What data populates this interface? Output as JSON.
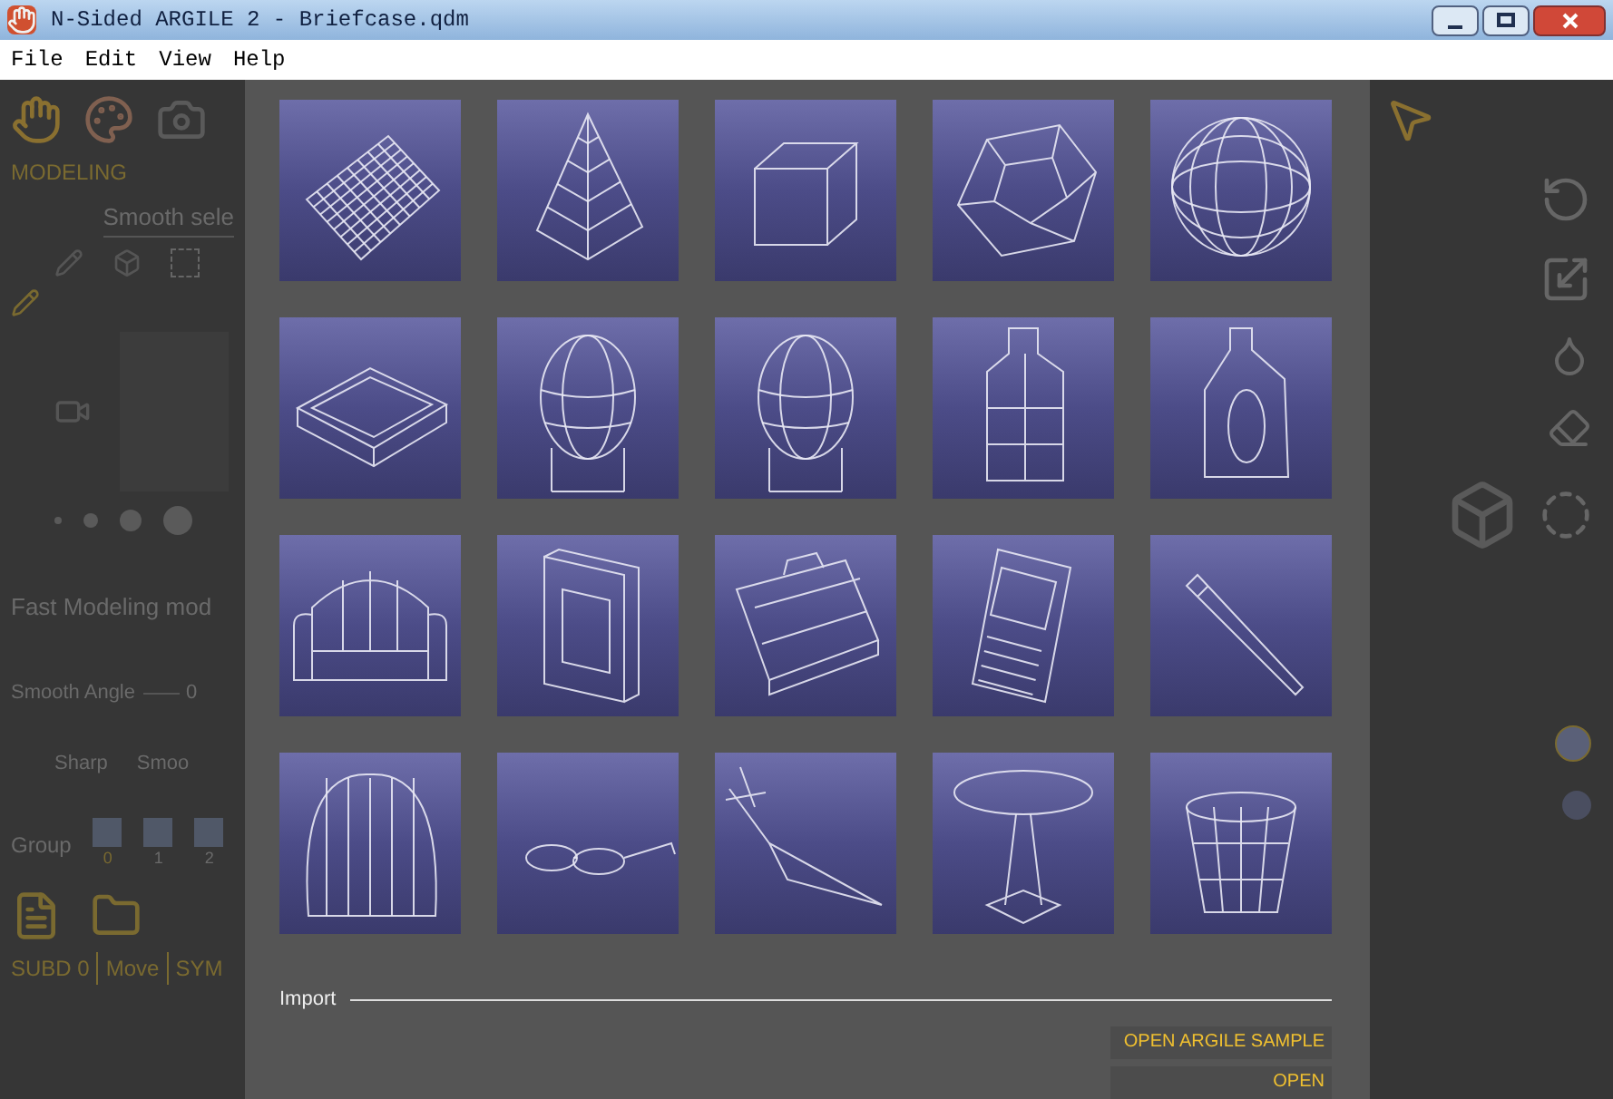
{
  "window": {
    "title": "N-Sided ARGILE 2 - Briefcase.qdm"
  },
  "menu": [
    "File",
    "Edit",
    "View",
    "Help"
  ],
  "left_panel": {
    "section": "MODELING",
    "smooth_select": "Smooth sele",
    "mode": "Fast Modeling mod",
    "smooth_angle_label": "Smooth Angle",
    "smooth_angle_value": "0",
    "sharp": "Sharp",
    "smooth": "Smoo",
    "group_label": "Group",
    "groups": [
      "0",
      "1",
      "2"
    ]
  },
  "status_bar": [
    "SUBD 0",
    "Move",
    "SYM"
  ],
  "gallery": {
    "thumbnails": [
      {
        "kind": "grid"
      },
      {
        "kind": "pyramid"
      },
      {
        "kind": "cube"
      },
      {
        "kind": "dodecahedron"
      },
      {
        "kind": "sphere"
      },
      {
        "kind": "tray"
      },
      {
        "kind": "head"
      },
      {
        "kind": "head"
      },
      {
        "kind": "bottle"
      },
      {
        "kind": "jug"
      },
      {
        "kind": "armchair"
      },
      {
        "kind": "book"
      },
      {
        "kind": "briefcase"
      },
      {
        "kind": "phone"
      },
      {
        "kind": "pen"
      },
      {
        "kind": "hair"
      },
      {
        "kind": "glasses"
      },
      {
        "kind": "branch"
      },
      {
        "kind": "table"
      },
      {
        "kind": "glass"
      }
    ],
    "import_label": "Import",
    "buttons": [
      "OPEN ARGILE SAMPLE",
      "OPEN"
    ]
  }
}
